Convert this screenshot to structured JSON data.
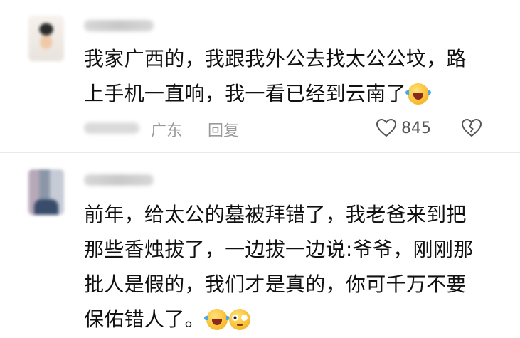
{
  "comments": [
    {
      "text_lines": [
        "我家广西的，我跟我外公去找太公公坟，路",
        "上手机一直响，我一看已经到云南了"
      ],
      "emojis": [
        "laugh-cry-emoji"
      ],
      "location": "广东",
      "reply_label": "回复",
      "like_count": "845"
    },
    {
      "text_lines": [
        "前年，给太公的墓被拜错了，我老爸来到把",
        "那些香烛拔了，一边拔一边说:爷爷，刚刚那",
        "批人是假的，我们才是真的，你可千万不要",
        "保佑错人了。"
      ],
      "emojis": [
        "laugh-cry-emoji",
        "flushed-emoji"
      ]
    }
  ],
  "colors": {
    "text": "#111111",
    "meta": "#9a9a9a",
    "divider": "#e9e9e9"
  }
}
